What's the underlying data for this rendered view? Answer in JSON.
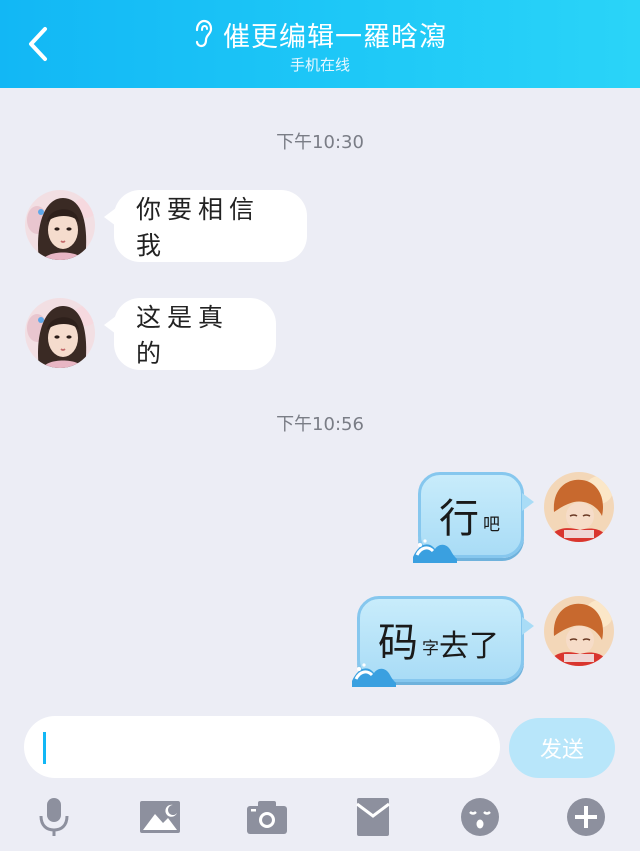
{
  "header": {
    "title": "催更编辑一羅晗瀉",
    "status": "手机在线",
    "back_icon": "chevron-left-icon",
    "mode_icon": "ear-icon"
  },
  "messages": {
    "time1": "下午10:30",
    "in1": "你要相信我",
    "in2": "这是真的",
    "time2": "下午10:56",
    "out1_big": "行",
    "out1_small": "吧",
    "out2_big": "码",
    "out2_small": "字",
    "out2_rest": "去了"
  },
  "composer": {
    "input_value": "",
    "send_label": "发送"
  },
  "toolbar": [
    "microphone-icon",
    "image-icon",
    "camera-icon",
    "red-packet-icon",
    "emoji-icon",
    "plus-icon"
  ],
  "colors": {
    "header_gradient_start": "#12b7f5",
    "header_gradient_end": "#2ad4f8",
    "background": "#ecedf5",
    "send_button": "#b8e6fa",
    "outgoing_bubble": "#a9dcf6",
    "toolbar_icon": "#8d909e"
  }
}
